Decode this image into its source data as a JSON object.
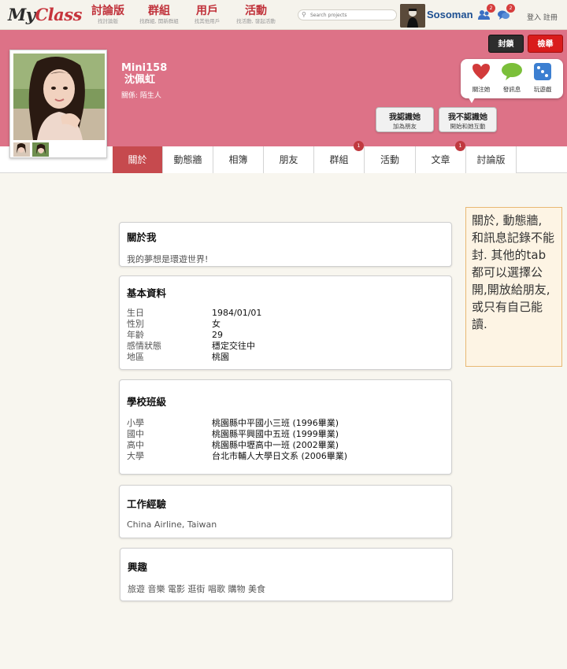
{
  "header": {
    "logo_my": "My",
    "logo_class": "Class",
    "nav": [
      {
        "label": "討論版",
        "sub": "找討論版"
      },
      {
        "label": "群組",
        "sub": "找群組, 開新群組"
      },
      {
        "label": "用戶",
        "sub": "找其他用戶"
      },
      {
        "label": "活動",
        "sub": "找活動, 發起活動"
      }
    ],
    "search_placeholder": "Search projects",
    "username": "Sosoman",
    "friend_requests": "2",
    "messages": "2",
    "login": "登入",
    "register": "註冊"
  },
  "profile": {
    "username": "Mini158",
    "real_name": "沈佩虹",
    "relation": "關係: 陌生人",
    "block_label": "封鎖",
    "report_label": "檢舉",
    "actions": [
      {
        "label": "關注她",
        "icon": "heart-icon"
      },
      {
        "label": "發訊息",
        "icon": "speech-bubble-icon"
      },
      {
        "label": "玩遊戲",
        "icon": "dice-icon"
      }
    ],
    "know_btn": {
      "title": "我認識她",
      "sub": "加為朋友"
    },
    "dont_know_btn": {
      "title": "我不認識她",
      "sub": "開始和她互動"
    }
  },
  "tabs": [
    {
      "label": "關於",
      "badge": ""
    },
    {
      "label": "動態牆",
      "badge": ""
    },
    {
      "label": "相簿",
      "badge": ""
    },
    {
      "label": "朋友",
      "badge": ""
    },
    {
      "label": "群組",
      "badge": "1"
    },
    {
      "label": "活動",
      "badge": ""
    },
    {
      "label": "文章",
      "badge": "1"
    },
    {
      "label": "討論版",
      "badge": ""
    }
  ],
  "about": {
    "title": "關於我",
    "text": "我的夢想是環遊世界!"
  },
  "basic": {
    "title": "基本資料",
    "rows": [
      {
        "k": "生日",
        "v": "1984/01/01"
      },
      {
        "k": "性別",
        "v": "女"
      },
      {
        "k": "年齡",
        "v": "29"
      },
      {
        "k": "感情狀態",
        "v": "穩定交往中"
      },
      {
        "k": "地區",
        "v": "桃園"
      }
    ]
  },
  "school": {
    "title": "學校班級",
    "rows": [
      {
        "k": "小學",
        "v": "桃園縣中平國小三班 (1996畢業)"
      },
      {
        "k": "國中",
        "v": "桃園縣平興國中五班 (1999畢業)"
      },
      {
        "k": "高中",
        "v": "桃園縣中壢高中一班 (2002畢業)"
      },
      {
        "k": "大學",
        "v": "台北市輔人大學日文系 (2006畢業)"
      }
    ]
  },
  "work": {
    "title": "工作經驗",
    "text": "China Airline, Taiwan"
  },
  "interests": {
    "title": "興趣",
    "text": "旅遊 音樂 電影 逛街 唱歌 購物 美食"
  },
  "annotation": "關於, 動態牆, 和訊息記錄不能封. 其他的tab都可以選擇公開,開放給朋友,或只有自己能讀."
}
